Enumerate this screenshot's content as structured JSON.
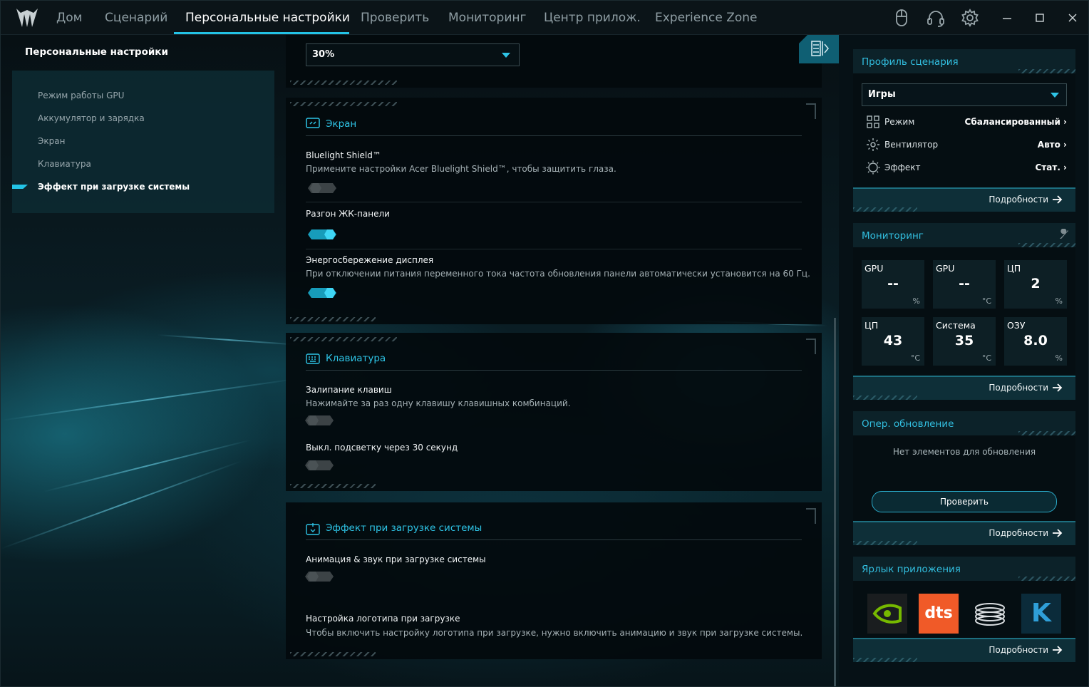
{
  "nav": {
    "tabs": [
      {
        "label": "Дом"
      },
      {
        "label": "Сценарий"
      },
      {
        "label": "Персональные настройки"
      },
      {
        "label": "Проверить"
      },
      {
        "label": "Мониторинг"
      },
      {
        "label": "Центр прилож."
      },
      {
        "label": "Experience Zone"
      }
    ],
    "active_tab": "Персональные настройки",
    "icons": [
      "mouse-icon",
      "headset-icon",
      "gear-icon"
    ],
    "window_controls": [
      "minimize-icon",
      "maximize-icon",
      "close-icon"
    ]
  },
  "sidebar": {
    "title": "Персональные настройки",
    "items": [
      {
        "label": "Режим работы GPU"
      },
      {
        "label": "Аккумулятор и зарядка"
      },
      {
        "label": "Экран"
      },
      {
        "label": "Клавиатура"
      },
      {
        "label": "Эффект при загрузке системы"
      }
    ],
    "active_item": "Эффект при загрузке системы"
  },
  "content": {
    "top_dropdown": {
      "value": "30%"
    },
    "screen": {
      "title": "Экран",
      "bluelight": {
        "title": "Bluelight Shield™",
        "desc": "Примените настройки Acer Bluelight Shield™, чтобы защитить глаза.",
        "on": false
      },
      "overdrive": {
        "title": "Разгон ЖК-панели",
        "on": true
      },
      "power_save": {
        "title": "Энергосбережение дисплея",
        "desc": "При отключении питания переменного тока частота обновления панели автоматически установится на 60 Гц.",
        "on": true
      }
    },
    "keyboard": {
      "title": "Клавиатура",
      "sticky": {
        "title": "Залипание клавиш",
        "desc": "Нажимайте за раз одну клавишу клавишных комбинаций.",
        "on": false
      },
      "backlight": {
        "title": "Выкл. подсветку через 30 секунд",
        "on": false
      }
    },
    "boot": {
      "title": "Эффект при загрузке системы",
      "animation": {
        "title": "Анимация & звук при загрузке системы",
        "on": false
      },
      "logo": {
        "title": "Настройка логотипа при загрузке",
        "desc": "Чтобы включить настройку логотипа при загрузке, нужно включить анимацию и звук при загрузке системы."
      }
    }
  },
  "right": {
    "profile": {
      "title": "Профиль сценария",
      "selected": "Игры",
      "rows": [
        {
          "label": "Режим",
          "value": "Сбалансированный",
          "icon": "grid-icon"
        },
        {
          "label": "Вентилятор",
          "value": "Авто",
          "icon": "fan-icon"
        },
        {
          "label": "Эффект",
          "value": "Стат.",
          "icon": "light-effect-icon"
        }
      ],
      "more": "Подробности"
    },
    "monitoring": {
      "title": "Мониторинг",
      "tiles": [
        {
          "label": "GPU",
          "value": "--",
          "unit": "%"
        },
        {
          "label": "GPU",
          "value": "--",
          "unit": "°C"
        },
        {
          "label": "ЦП",
          "value": "2",
          "unit": "%"
        },
        {
          "label": "ЦП",
          "value": "43",
          "unit": "°C"
        },
        {
          "label": "Система",
          "value": "35",
          "unit": "°C"
        },
        {
          "label": "ОЗУ",
          "value": "8.0",
          "unit": "%"
        }
      ],
      "more": "Подробности"
    },
    "update": {
      "title": "Опер. обновление",
      "message": "Нет элементов для обновления",
      "button": "Проверить",
      "more": "Подробности"
    },
    "shortcuts": {
      "title": "Ярлык приложения",
      "apps": [
        {
          "icon": "nvidia-icon",
          "color": "#76b900"
        },
        {
          "icon": "dts-icon",
          "color": "#f05a28",
          "text": "dts"
        },
        {
          "icon": "coil-icon",
          "color": "#d8dcdf"
        },
        {
          "icon": "k-app-icon",
          "color": "#2f9fd8",
          "text": "K"
        }
      ],
      "more": "Подробности"
    }
  },
  "colors": {
    "accent": "#23c3e6",
    "toggle_on": "#1bb6d8",
    "toggle_off": "#3c4346"
  }
}
